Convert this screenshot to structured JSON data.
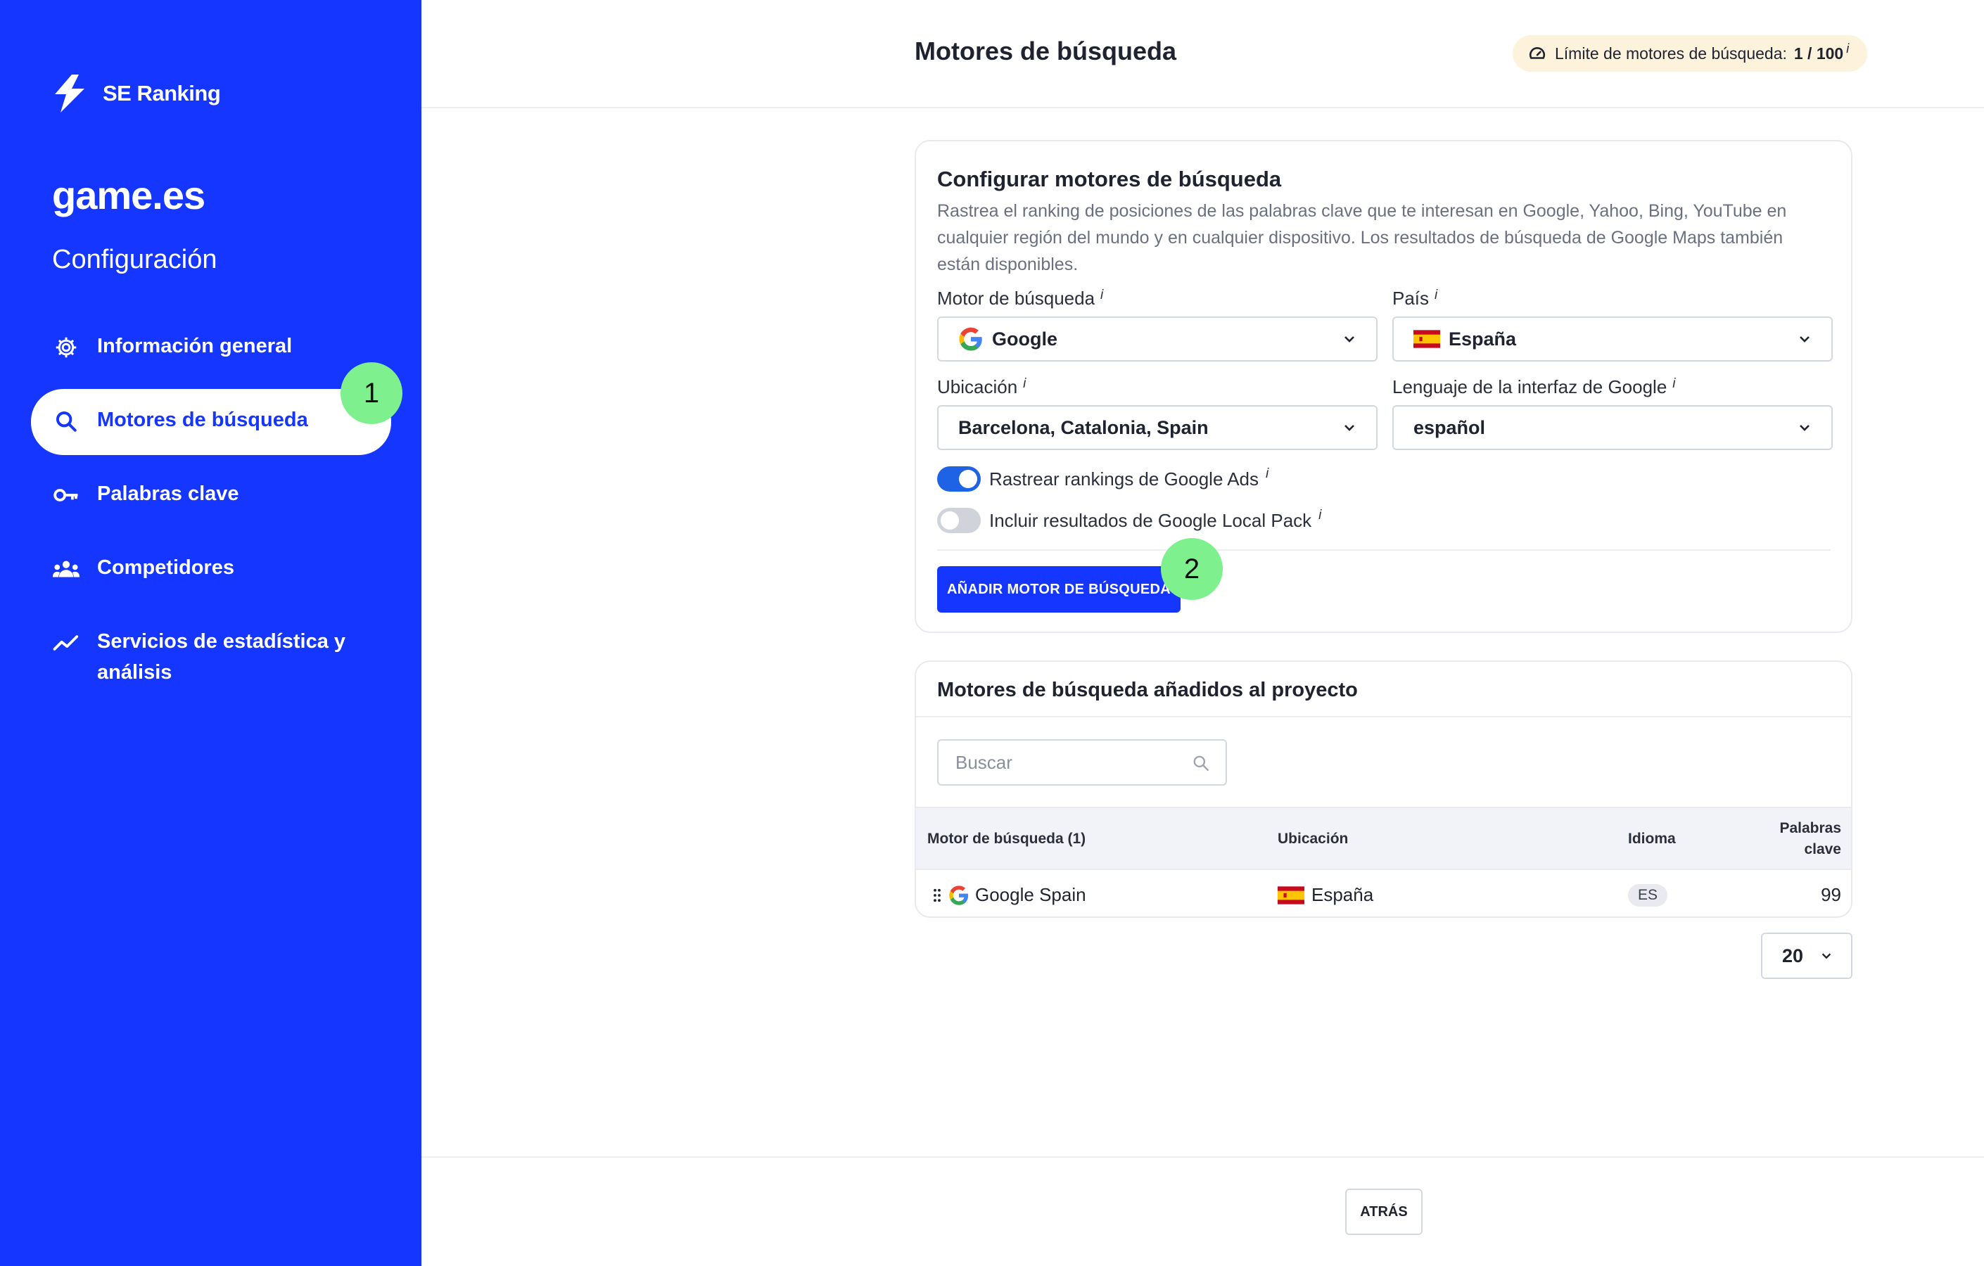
{
  "brand": {
    "name": "SE Ranking"
  },
  "project": {
    "name": "game.es",
    "section": "Configuración"
  },
  "sidebar": {
    "items": [
      {
        "label": "Información general",
        "icon": "gear-icon",
        "active": false
      },
      {
        "label": "Motores de búsqueda",
        "icon": "search-icon",
        "active": true
      },
      {
        "label": "Palabras clave",
        "icon": "key-icon",
        "active": false
      },
      {
        "label": "Competidores",
        "icon": "users-icon",
        "active": false
      },
      {
        "label": "Servicios de estadística y análisis",
        "icon": "trend-icon",
        "active": false
      }
    ]
  },
  "steps": {
    "one": "1",
    "two": "2"
  },
  "header": {
    "title": "Motores de búsqueda",
    "limit_label": "Límite de motores de búsqueda:",
    "limit_value": "1 / 100",
    "info": "i"
  },
  "configure": {
    "title": "Configurar motores de búsqueda",
    "description": "Rastrea el ranking de posiciones de las palabras clave que te interesan en Google, Yahoo, Bing, YouTube en cualquier región del mundo y en cualquier dispositivo. Los resultados de búsqueda de Google Maps también están disponibles.",
    "engine_label": "Motor de búsqueda",
    "engine_value": "Google",
    "country_label": "País",
    "country_value": "España",
    "location_label": "Ubicación",
    "location_value": "Barcelona, Catalonia, Spain",
    "language_label": "Lenguaje de la interfaz de Google",
    "language_value": "español",
    "toggle_ads_label": "Rastrear rankings de Google Ads",
    "toggle_ads_on": true,
    "toggle_local_label": "Incluir resultados de Google Local Pack",
    "toggle_local_on": false,
    "add_button": "AÑADIR MOTOR DE BÚSQUEDA",
    "info": "i"
  },
  "added": {
    "title": "Motores de búsqueda añadidos al proyecto",
    "search_placeholder": "Buscar",
    "columns": {
      "engine": "Motor de búsqueda (1)",
      "location": "Ubicación",
      "language": "Idioma",
      "keywords_line1": "Palabras",
      "keywords_line2": "clave"
    },
    "rows": [
      {
        "engine": "Google Spain",
        "location": "España",
        "language": "ES",
        "keywords": "99"
      }
    ]
  },
  "pager": {
    "per_page": "20"
  },
  "footer": {
    "back_button": "ATRÁS"
  },
  "colors": {
    "brand_blue": "#1436ff",
    "step_green": "#7ff08e",
    "toggle_on": "#1e63e6",
    "limit_bg": "#fdf3dc"
  }
}
